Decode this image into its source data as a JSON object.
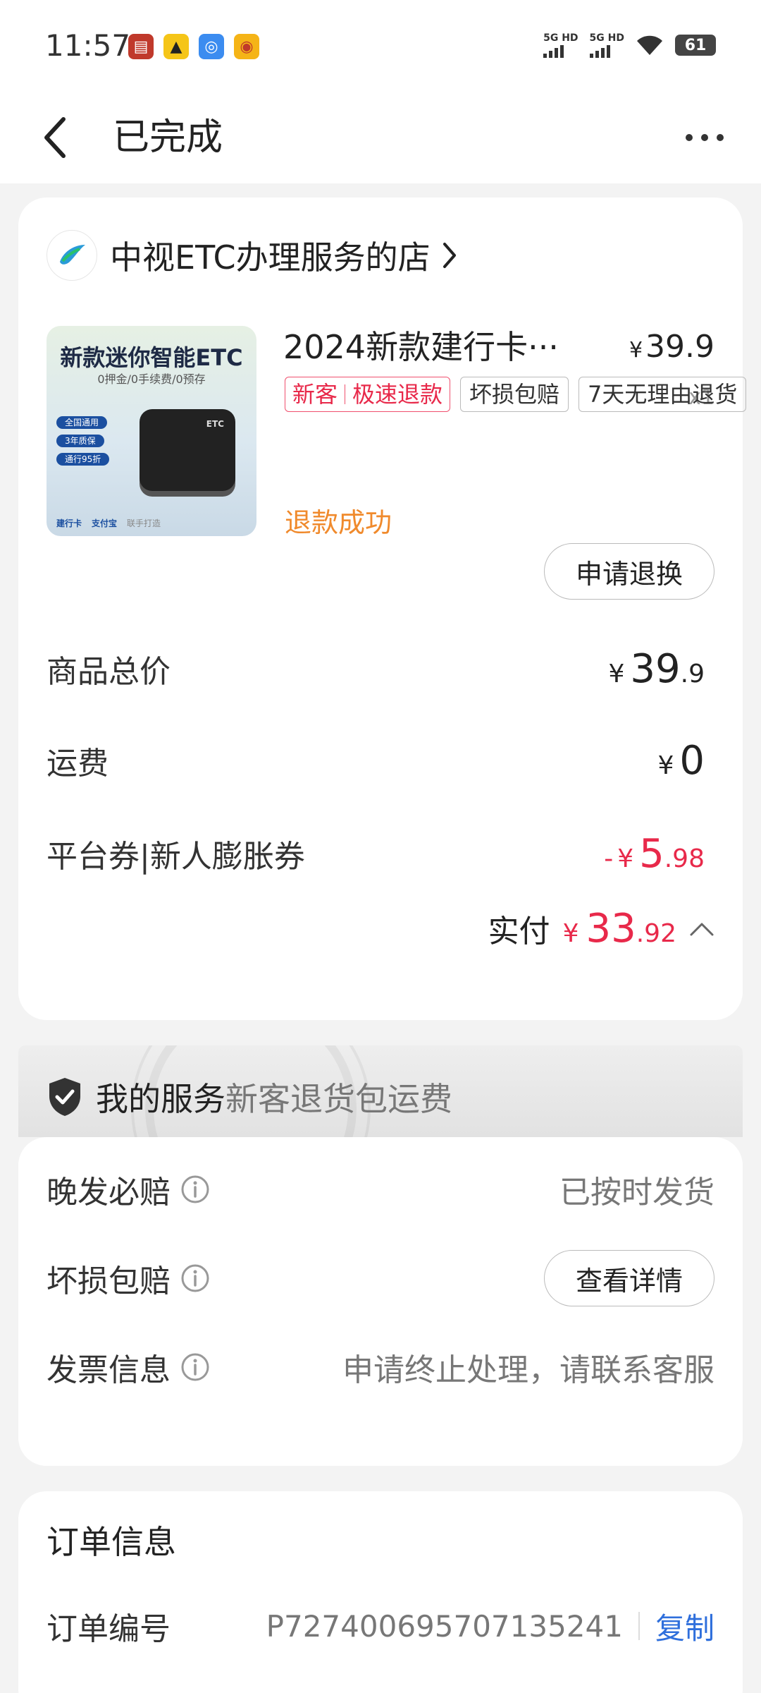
{
  "status_bar": {
    "time": "11:57",
    "app_icons": [
      {
        "name": "card-app-icon",
        "bg": "#c0392b",
        "glyph": "卡"
      },
      {
        "name": "car-app-icon",
        "bg": "#f5c518",
        "glyph": "⛑"
      },
      {
        "name": "safety-app-icon",
        "bg": "#3b8cf0",
        "glyph": "◎"
      },
      {
        "name": "weibo-icon",
        "bg": "#f5b417",
        "glyph": "◉"
      }
    ],
    "signal_1_label": "5G HD",
    "signal_2_label": "5G HD",
    "battery": "61"
  },
  "nav": {
    "title": "已完成"
  },
  "shop": {
    "name": "中视ETC办理服务的店"
  },
  "product": {
    "image": {
      "title": "新款迷你智能ETC",
      "subtitle": "0押金/0手续费/0预存",
      "chips": [
        "全国通用",
        "3年质保",
        "通行95折"
      ],
      "device_label": "ETC",
      "footer": [
        "建行卡",
        "支付宝",
        "联手打造"
      ]
    },
    "name": "2024新款建行卡···",
    "price_currency": "¥",
    "price": "39.9",
    "quantity": "x1",
    "tags": {
      "new_customer": "新客",
      "fast_refund": "极速退款",
      "damage": "坏损包赔",
      "return": "7天无理由退货"
    },
    "refund_status": "退款成功",
    "exchange_button": "申请退换"
  },
  "fees": {
    "total_label": "商品总价",
    "total_currency": "¥",
    "total_int": "39",
    "total_dec": ".9",
    "shipping_label": "运费",
    "shipping_currency": "¥",
    "shipping_int": "0",
    "coupon_label": "平台券|新人膨胀券",
    "coupon_minus": "-",
    "coupon_currency": "¥",
    "coupon_int": "5",
    "coupon_dec": ".98",
    "paid_label": "实付",
    "paid_currency": "¥",
    "paid_int": "33",
    "paid_dec": ".92"
  },
  "service": {
    "title": "我的服务",
    "subtitle": "新客退货包运费",
    "rows": [
      {
        "label": "晚发必赔",
        "value": "已按时发货"
      },
      {
        "label": "坏损包赔",
        "button": "查看详情"
      },
      {
        "label": "发票信息",
        "value": "申请终止处理，请联系客服"
      }
    ]
  },
  "order_info": {
    "title": "订单信息",
    "number_label": "订单编号",
    "number": "P727400695707135241",
    "copy_label": "复制"
  },
  "colors": {
    "accent_red": "#e8294a",
    "refund_orange": "#f08a2c",
    "link_blue": "#2f6fdc"
  }
}
